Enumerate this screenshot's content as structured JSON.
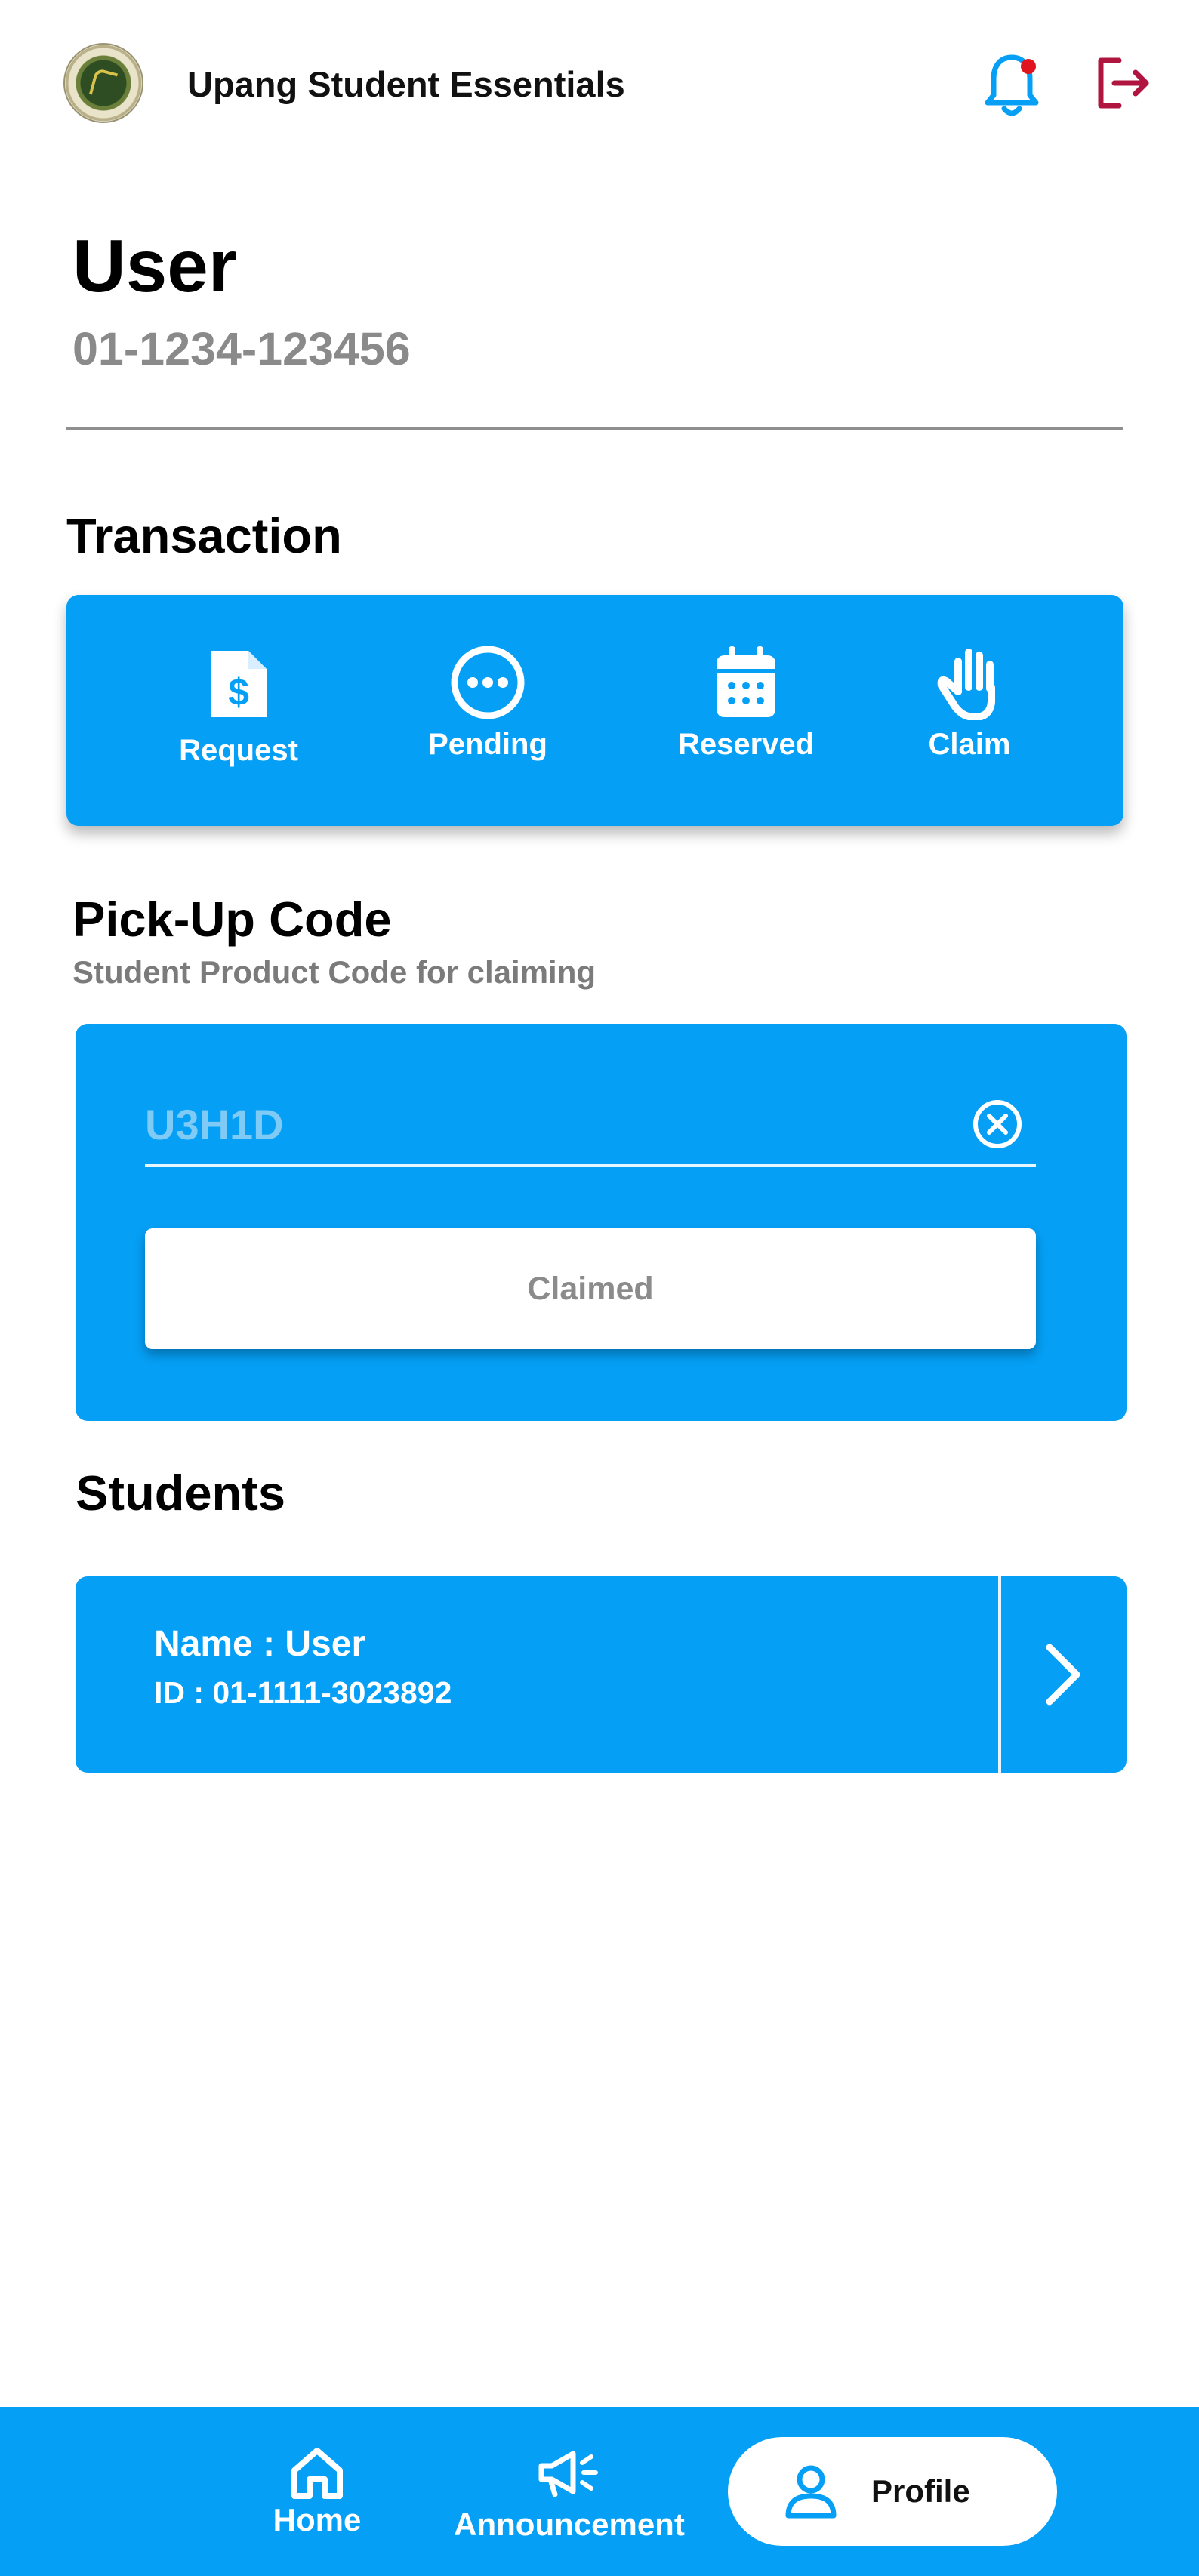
{
  "header": {
    "title": "Upang Student Essentials",
    "logo_icon": "university-seal-logo",
    "notification_icon": "bell-icon",
    "logout_icon": "logout-icon",
    "notification_color": "#059ff5",
    "logout_color": "#b0153f"
  },
  "user": {
    "name": "User",
    "id": "01-1234-123456"
  },
  "transaction": {
    "title": "Transaction",
    "items": [
      {
        "label": "Request",
        "icon": "invoice-dollar-icon"
      },
      {
        "label": "Pending",
        "icon": "more-horizontal-circle-icon"
      },
      {
        "label": "Reserved",
        "icon": "calendar-icon"
      },
      {
        "label": "Claim",
        "icon": "hand-icon"
      }
    ]
  },
  "pickup": {
    "title": "Pick-Up Code",
    "subtitle": "Student Product Code for claiming",
    "code_value": "U3H1D",
    "clear_icon": "clear-circle-icon",
    "button_label": "Claimed"
  },
  "students": {
    "title": "Students",
    "items": [
      {
        "name": "Name : User",
        "id": "ID : 01-1111-3023892",
        "icon": "chevron-right-icon"
      }
    ]
  },
  "nav": {
    "items": [
      {
        "label": "Home",
        "icon": "home-icon"
      },
      {
        "label": "Announcement",
        "icon": "megaphone-icon"
      },
      {
        "label": "Profile",
        "icon": "user-icon",
        "active": true
      }
    ]
  },
  "colors": {
    "primary": "#059ff5",
    "white": "#ffffff",
    "muted_text": "#8a8a8a"
  }
}
